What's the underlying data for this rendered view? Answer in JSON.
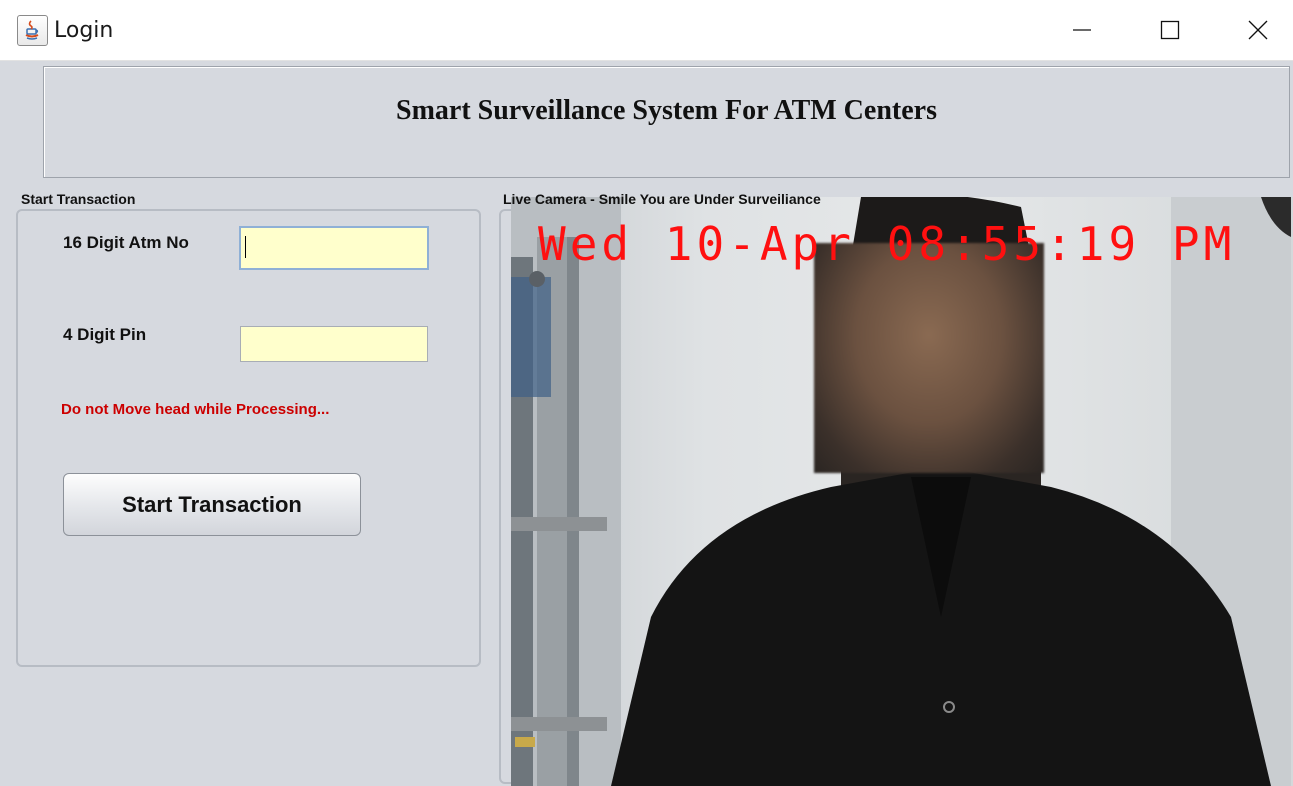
{
  "window": {
    "title": "Login",
    "icons": [
      "java-app-icon",
      "minimize-icon",
      "maximize-icon",
      "close-icon"
    ]
  },
  "header": {
    "title": "Smart Surveillance System For ATM Centers"
  },
  "transaction": {
    "group_label": "Start Transaction",
    "atm_label": "16 Digit Atm No",
    "atm_value": "",
    "pin_label": "4 Digit Pin",
    "pin_value": "",
    "warning": "Do not Move head while Processing...",
    "button_label": "Start Transaction"
  },
  "camera": {
    "group_label": "Live Camera - Smile You are Under Surveiliance",
    "timestamp": "Wed 10-Apr 08:55:19 PM"
  },
  "colors": {
    "field_bg": "#ffffcc",
    "warning": "#cc0000",
    "timestamp": "#ff1010",
    "panel_bg": "#d6d9df"
  }
}
